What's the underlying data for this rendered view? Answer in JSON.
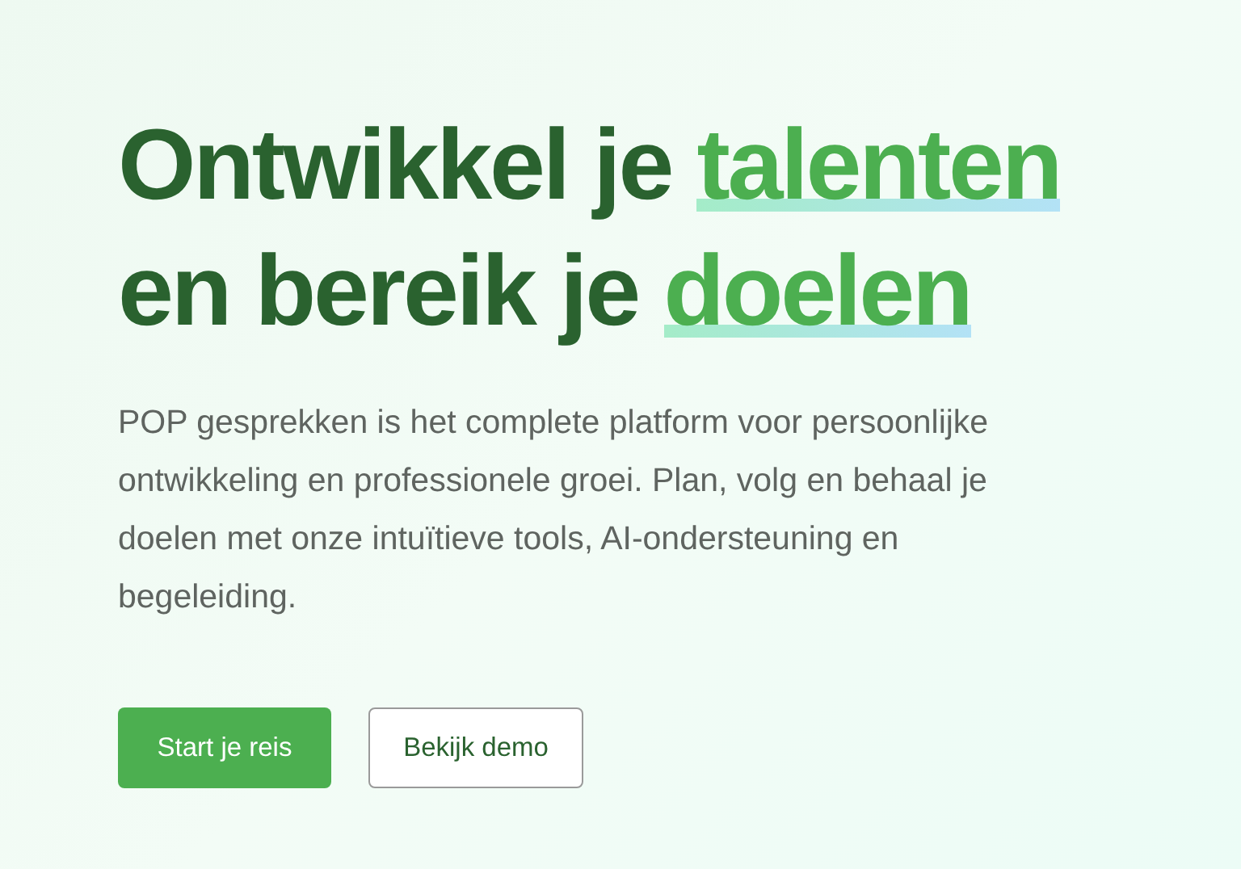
{
  "headline": {
    "lines": [
      [
        {
          "text": "Ontwikkel je ",
          "highlight": false
        },
        {
          "text": "talenten",
          "highlight": true
        }
      ],
      [
        {
          "text": "en bereik je ",
          "highlight": false
        },
        {
          "text": "doelen",
          "highlight": true
        }
      ]
    ]
  },
  "intro": "POP gesprekken is het complete platform voor persoonlijke ontwikkeling en professionele groei. Plan, volg en behaal je doelen met onze intuïtieve tools, AI-ondersteuning en begeleiding.",
  "buttons": [
    {
      "label": "Start je reis",
      "kind": "primary"
    },
    {
      "label": "Bekijk demo",
      "kind": "secondary"
    }
  ]
}
